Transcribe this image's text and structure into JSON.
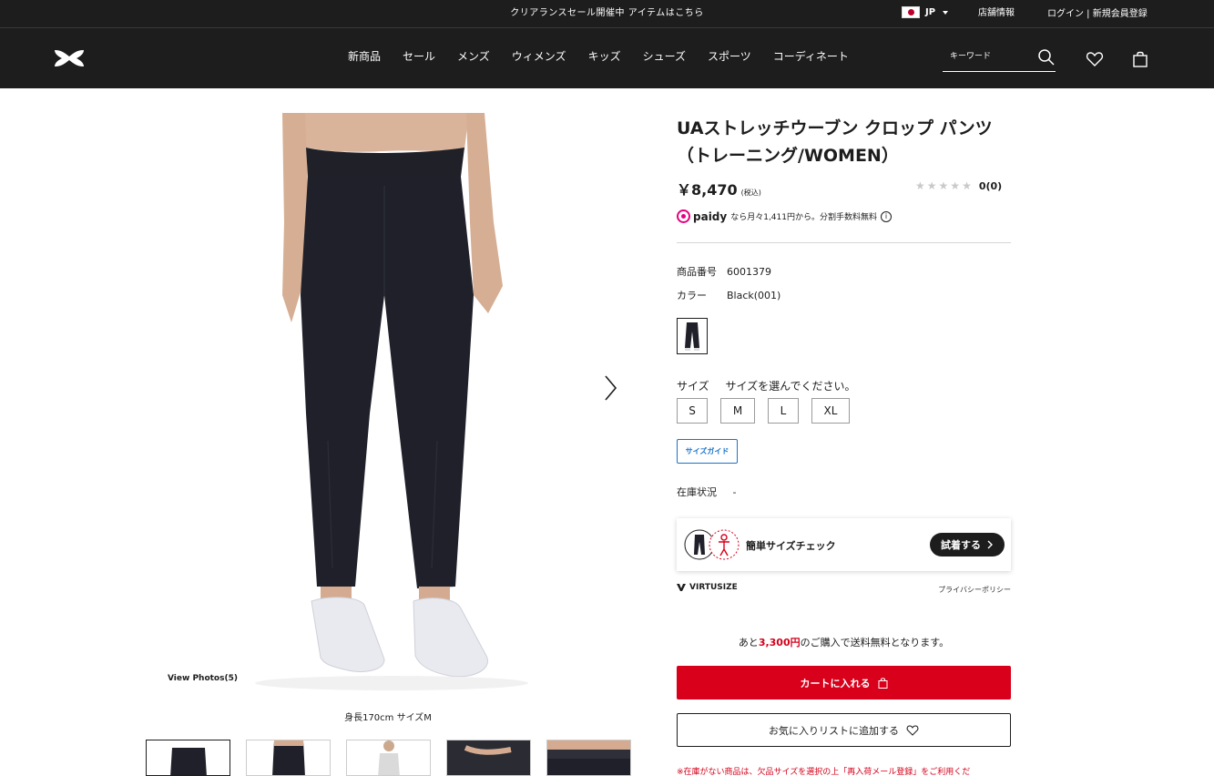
{
  "topbar": {
    "promo": "クリアランスセール開催中 アイテムはこちら",
    "locale": "JP",
    "stores": "店舗情報",
    "login": "ログイン | 新規会員登録"
  },
  "header": {
    "nav": [
      "新商品",
      "セール",
      "メンズ",
      "ウィメンズ",
      "キッズ",
      "シューズ",
      "スポーツ",
      "コーディネート"
    ],
    "search_placeholder": "キーワード"
  },
  "gallery": {
    "view_photos": "View Photos(5)",
    "caption": "身長170cm サイズM"
  },
  "product": {
    "title_line1": "UAストレッチウーブン クロップ パンツ",
    "title_line2": "（トレーニング/WOMEN）",
    "price": "￥8,470",
    "tax_note": "(税込)",
    "rating_count": "0",
    "review_count": "(0)",
    "rating_value": 0,
    "paidy_brand": "paidy",
    "paidy_text": "なら月々1,411円から。分割手数料無料",
    "product_no_label": "商品番号",
    "product_no": "6001379",
    "color_label": "カラー",
    "color_value": "Black(001)",
    "size_label": "サイズ",
    "size_prompt": "サイズを選んでください。",
    "sizes": [
      "S",
      "M",
      "L",
      "XL"
    ],
    "size_guide": "サイズガイド",
    "stock_label": "在庫状況",
    "stock_value": "-"
  },
  "virtusize": {
    "check_label": "簡単サイズチェック",
    "try_label": "試着する",
    "brand": "VIRTUSIZE",
    "privacy": "プライバシーポリシー"
  },
  "purchase": {
    "ship_prefix": "あと",
    "ship_amount": "3,300円",
    "ship_suffix": "のご購入で送料無料となります。",
    "cart_label": "カートに入れる",
    "fav_label": "お気に入りリストに追加する",
    "notice": "※在庫がない商品は、欠品サイズを選択の上「再入荷メール登録」をご利用くだ"
  },
  "colors": {
    "header_bg": "#1d1d1d",
    "cart_red": "#d8001a",
    "link_blue": "#1a73c9",
    "paidy_pink": "#e5007f"
  }
}
